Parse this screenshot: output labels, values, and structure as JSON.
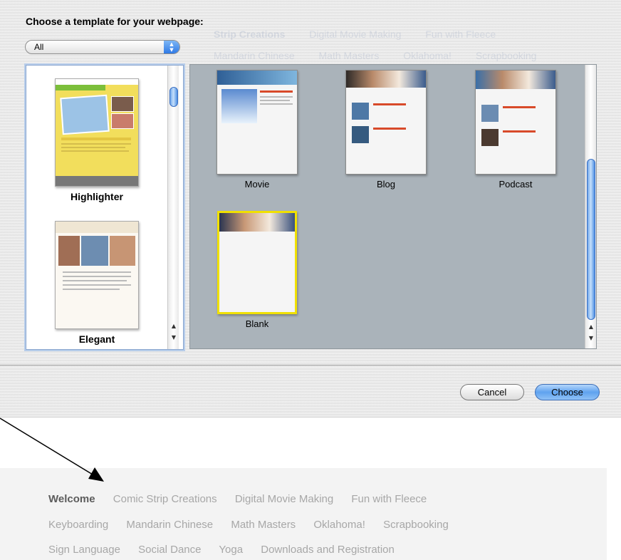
{
  "dialog": {
    "prompt": "Choose a template for your webpage:",
    "filter": {
      "selected": "All"
    },
    "left_templates": [
      {
        "label": "Highlighter"
      },
      {
        "label": "Elegant"
      }
    ],
    "grid_templates": [
      {
        "label": "Movie"
      },
      {
        "label": "Blog"
      },
      {
        "label": "Podcast"
      },
      {
        "label": "Blank",
        "selected": true
      }
    ],
    "buttons": {
      "cancel": "Cancel",
      "choose": "Choose"
    }
  },
  "background_nav": {
    "row1": [
      "Strip Creations",
      "Digital Movie Making",
      "Fun with Fleece"
    ],
    "row2": [
      "Mandarin Chinese",
      "Math Masters",
      "Oklahoma!",
      "Scrapbooking"
    ]
  },
  "page_nav": {
    "row1": [
      "Welcome",
      "Comic Strip Creations",
      "Digital Movie Making",
      "Fun with Fleece"
    ],
    "row2": [
      "Keyboarding",
      "Mandarin Chinese",
      "Math Masters",
      "Oklahoma!",
      "Scrapbooking"
    ],
    "row3": [
      "Sign Language",
      "Social Dance",
      "Yoga",
      "Downloads and Registration"
    ],
    "current": "Welcome"
  },
  "colors": {
    "accent": "#3b82e6",
    "selection": "#f0e000",
    "grid_bg": "#aab3ba",
    "highlighter_yellow": "#f2de5c",
    "nav_text": "#a7a7a7"
  }
}
